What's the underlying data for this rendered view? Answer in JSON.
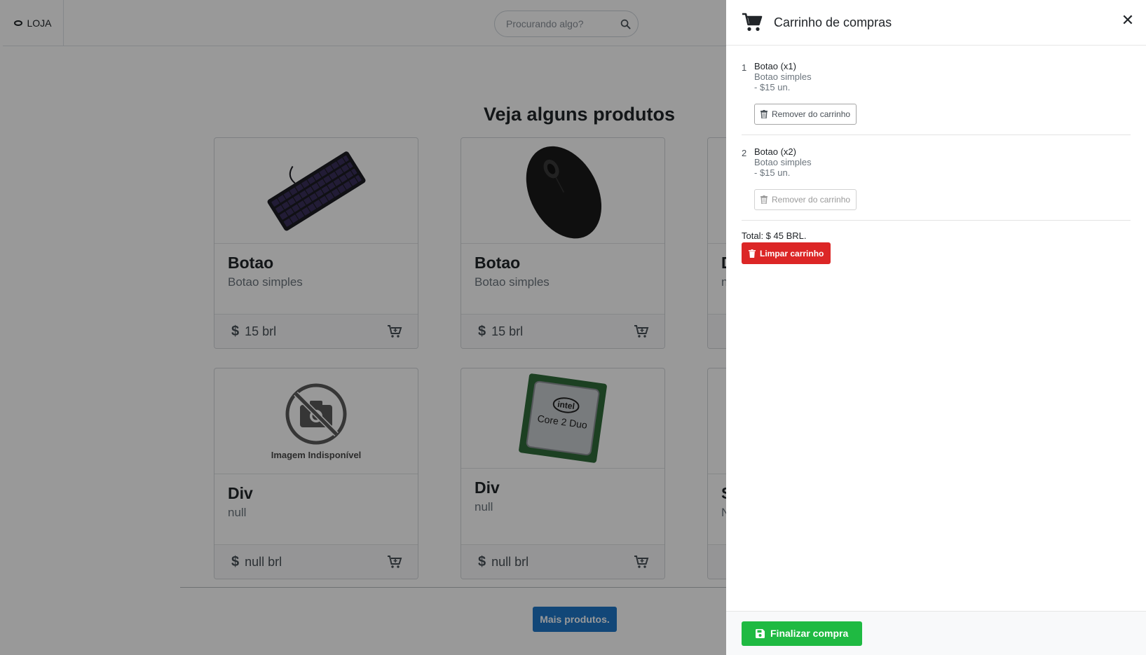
{
  "navbar": {
    "brand": "LOJA",
    "search_placeholder": "Procurando algo?"
  },
  "main": {
    "heading": "Veja alguns produtos",
    "products": [
      {
        "title": "Botao",
        "subtitle": "Botao simples",
        "price": "15 brl",
        "image": "keyboard"
      },
      {
        "title": "Botao",
        "subtitle": "Botao simples",
        "price": "15 brl",
        "image": "mouse"
      },
      {
        "title": "D",
        "subtitle": "n",
        "price": "",
        "image": "none"
      },
      {
        "title": "Div",
        "subtitle": "null",
        "price": "null brl",
        "image": "unavailable"
      },
      {
        "title": "Div",
        "subtitle": "null",
        "price": "null brl",
        "image": "cpu"
      },
      {
        "title": "S",
        "subtitle": "N",
        "price": "",
        "image": "none"
      }
    ],
    "unavailable_label": "Imagem Indisponível",
    "cpu_label_brand": "intel",
    "cpu_label_model": "Core 2 Duo",
    "more_button": "Mais produtos."
  },
  "cart": {
    "title": "Carrinho de compras",
    "items": [
      {
        "index": "1",
        "name": "Botao (x1)",
        "desc": "Botao simples",
        "unit": "- $15 un.",
        "remove_label": "Remover do carrinho"
      },
      {
        "index": "2",
        "name": "Botao (x2)",
        "desc": "Botao simples",
        "unit": "- $15 un.",
        "remove_label": "Remover do carrinho"
      }
    ],
    "total": "Total: $ 45 BRL.",
    "clear_label": "Limpar carrinho",
    "checkout_label": "Finalizar compra"
  },
  "colors": {
    "primary": "#1f77c9",
    "danger": "#dc2626",
    "success": "#1fba42"
  }
}
